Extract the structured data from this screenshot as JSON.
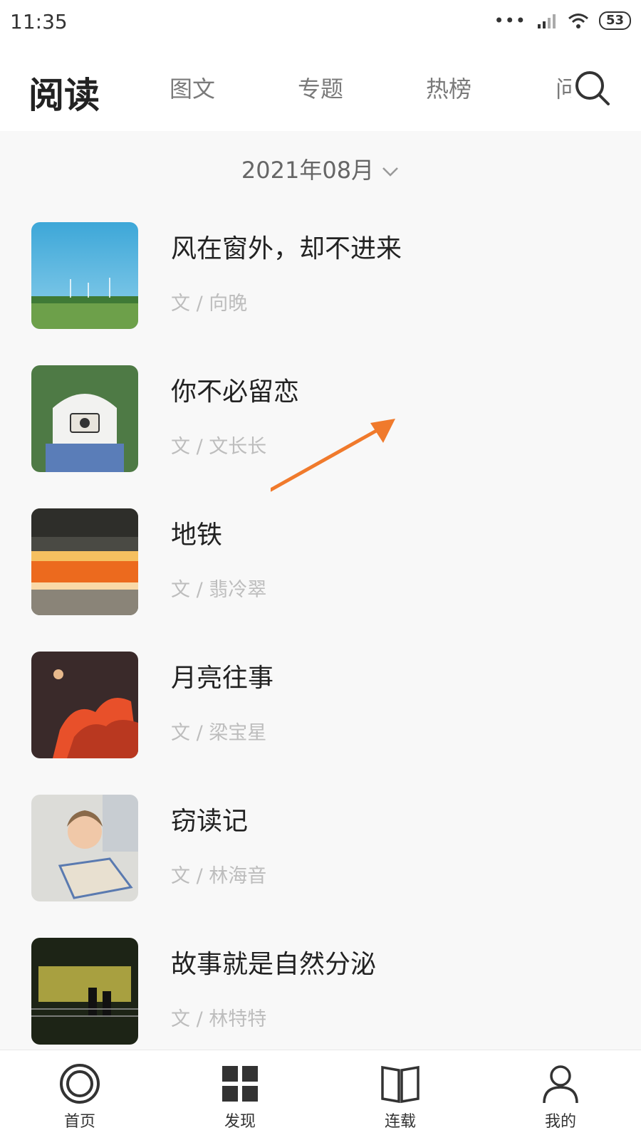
{
  "status": {
    "time": "11:35",
    "battery": "53"
  },
  "nav": {
    "title": "阅读",
    "tabs": [
      "图文",
      "专题",
      "热榜",
      "问"
    ]
  },
  "month": "2021年08月",
  "articles": [
    {
      "title": "风在窗外，却不进来",
      "author": "文 / 向晚"
    },
    {
      "title": "你不必留恋",
      "author": "文 / 文长长"
    },
    {
      "title": "地铁",
      "author": "文 / 翡冷翠"
    },
    {
      "title": "月亮往事",
      "author": "文 / 梁宝星"
    },
    {
      "title": "窃读记",
      "author": "文 / 林海音"
    },
    {
      "title": "故事就是自然分泌",
      "author": "文 / 林特特"
    }
  ],
  "bottom_nav": [
    {
      "label": "首页",
      "icon": "home-ring-icon"
    },
    {
      "label": "发现",
      "icon": "grid-icon"
    },
    {
      "label": "连载",
      "icon": "book-icon"
    },
    {
      "label": "我的",
      "icon": "user-icon"
    }
  ],
  "colors": {
    "accent": "#f07a2c",
    "text": "#222222",
    "muted": "#bdbdbd"
  }
}
